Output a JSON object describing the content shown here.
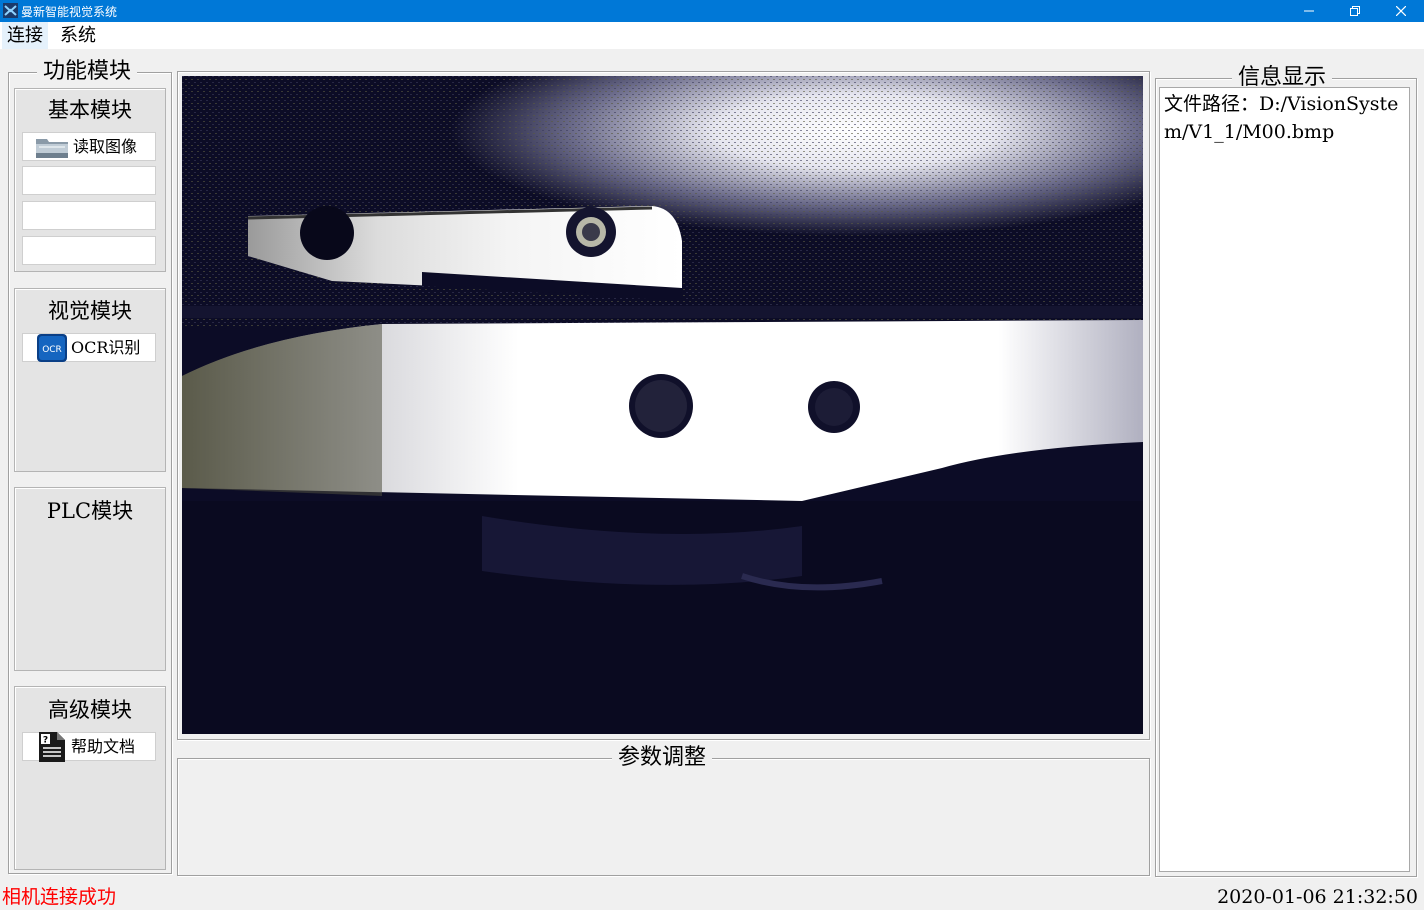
{
  "window": {
    "title": "曼新智能视觉系统",
    "title_bar_color": "#0078d7",
    "icons": [
      "app-icon",
      "minimize-icon",
      "restore-icon",
      "close-icon"
    ]
  },
  "menu": {
    "items": [
      {
        "label": "连接"
      },
      {
        "label": "系统"
      }
    ]
  },
  "function_panel": {
    "title": "功能模块",
    "modules": [
      {
        "title": "基本模块",
        "buttons": [
          {
            "label": "读取图像",
            "icon": "folder-icon"
          },
          {
            "label": ""
          },
          {
            "label": ""
          },
          {
            "label": ""
          }
        ]
      },
      {
        "title": "视觉模块",
        "buttons": [
          {
            "label": "OCR识别",
            "icon": "ocr-icon",
            "icon_text": "OCR"
          }
        ]
      },
      {
        "title": "PLC模块",
        "buttons": []
      },
      {
        "title": "高级模块",
        "buttons": [
          {
            "label": "帮助文档",
            "icon": "help-document-icon"
          }
        ]
      }
    ]
  },
  "param_panel": {
    "title": "参数调整"
  },
  "info_panel": {
    "title": "信息显示",
    "text": "文件路径：D:/VisionSystem/V1_1/M00.bmp"
  },
  "status_bar": {
    "message": "相机连接成功",
    "message_color": "#ff0000",
    "datetime": "2020-01-06 21:32:50"
  }
}
